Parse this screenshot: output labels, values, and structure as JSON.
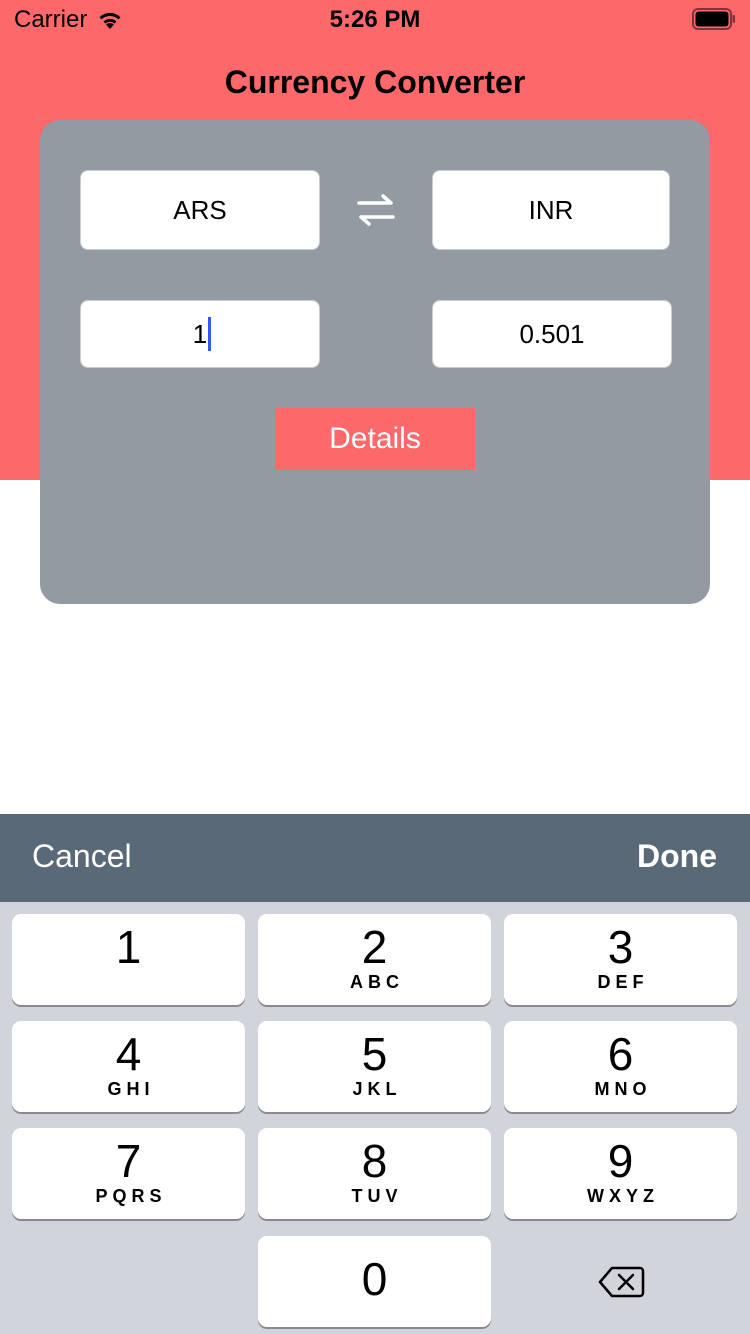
{
  "status_bar": {
    "carrier": "Carrier",
    "time": "5:26 PM"
  },
  "header": {
    "title": "Currency Converter"
  },
  "converter": {
    "from_currency": "ARS",
    "to_currency": "INR",
    "amount": "1",
    "result": "0.501",
    "details_label": "Details"
  },
  "toolbar": {
    "cancel_label": "Cancel",
    "done_label": "Done"
  },
  "keypad": {
    "keys": [
      {
        "digit": "1",
        "letters": ""
      },
      {
        "digit": "2",
        "letters": "ABC"
      },
      {
        "digit": "3",
        "letters": "DEF"
      },
      {
        "digit": "4",
        "letters": "GHI"
      },
      {
        "digit": "5",
        "letters": "JKL"
      },
      {
        "digit": "6",
        "letters": "MNO"
      },
      {
        "digit": "7",
        "letters": "PQRS"
      },
      {
        "digit": "8",
        "letters": "TUV"
      },
      {
        "digit": "9",
        "letters": "WXYZ"
      },
      {
        "digit": "0",
        "letters": ""
      }
    ],
    "delete_icon": "backspace-icon"
  },
  "colors": {
    "brand": "#fd686b",
    "card": "#939aa1",
    "toolbar": "#5a6977",
    "keyboard": "#d1d4da",
    "caret": "#2b5cf5"
  }
}
